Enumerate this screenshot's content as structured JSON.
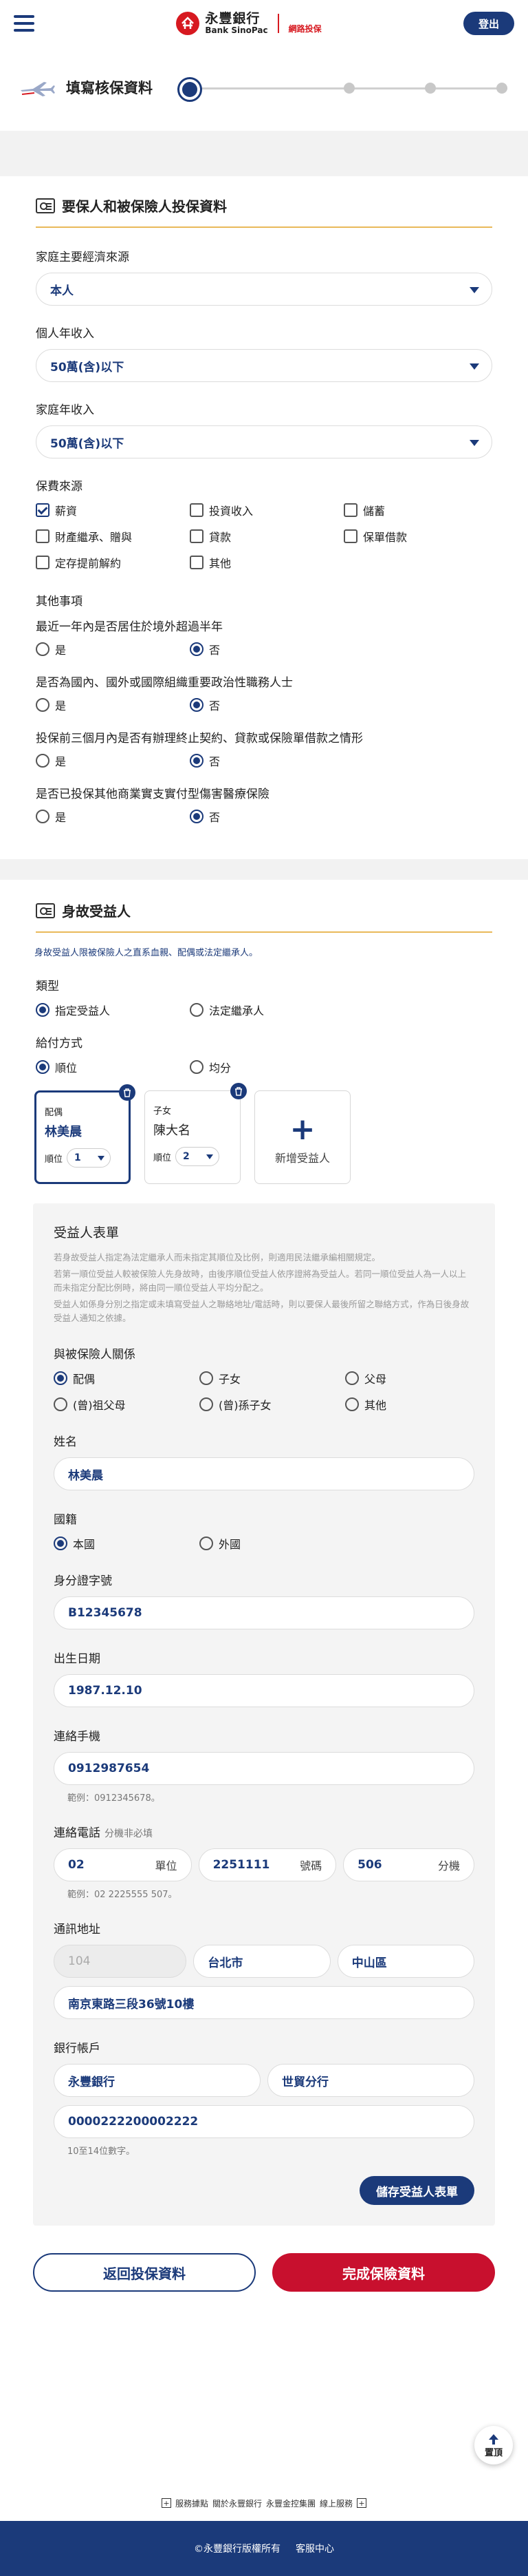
{
  "header": {
    "brand_cn": "永豐銀行",
    "brand_en": "Bank SinoPac",
    "brand_tag": "網路投保",
    "logout_label": "登出"
  },
  "stepper": {
    "title": "填寫核保資料",
    "current_step": 1,
    "total_steps": 4
  },
  "policyholder": {
    "title": "要保人和被保險人投保資料",
    "income_source_label": "家庭主要經濟來源",
    "income_source_value": "本人",
    "personal_income_label": "個人年收入",
    "personal_income_value": "50萬(含)以下",
    "family_income_label": "家庭年收入",
    "family_income_value": "50萬(含)以下",
    "premium_source_label": "保費來源",
    "premium_sources": [
      {
        "label": "薪資",
        "checked": true
      },
      {
        "label": "投資收入",
        "checked": false
      },
      {
        "label": "儲蓄",
        "checked": false
      },
      {
        "label": "財產繼承、贈與",
        "checked": false
      },
      {
        "label": "貸款",
        "checked": false
      },
      {
        "label": "保單借款",
        "checked": false
      },
      {
        "label": "定存提前解約",
        "checked": false
      },
      {
        "label": "其他",
        "checked": false
      }
    ],
    "other_label": "其他事項",
    "yes_label": "是",
    "no_label": "否",
    "questions": [
      {
        "text": "最近一年內是否居住於境外超過半年",
        "answer": "否"
      },
      {
        "text": "是否為國內、國外或國際組織重要政治性職務人士",
        "answer": "否"
      },
      {
        "text": "投保前三個月內是否有辦理終止契約、貸款或保險單借款之情形",
        "answer": "否"
      },
      {
        "text": "是否已投保其他商業實支實付型傷害醫療保險",
        "answer": "否"
      }
    ]
  },
  "beneficiary": {
    "title": "身故受益人",
    "note": "身故受益人限被保險人之直系血親、配偶或法定繼承人。",
    "type_label": "類型",
    "type_options": [
      "指定受益人",
      "法定繼承人"
    ],
    "type_selected": "指定受益人",
    "pay_label": "給付方式",
    "pay_options": [
      "順位",
      "均分"
    ],
    "pay_selected": "順位",
    "order_label": "順位",
    "cards": [
      {
        "relation": "配偶",
        "name": "林美晨",
        "order": "1"
      },
      {
        "relation": "子女",
        "name": "陳大名",
        "order": "2"
      }
    ],
    "add_label": "新增受益人",
    "form": {
      "title": "受益人表單",
      "notes": [
        "若身故受益人指定為法定繼承人而未指定其順位及比例，則適用民法繼承編相關規定。",
        "若第一順位受益人較被保險人先身故時，由後序順位受益人依序證將為受益人。若同一順位受益人為一人以上而未指定分配比例時，將由同一順位受益人平均分配之。",
        "受益人如係身分別之指定或未填寫受益人之聯絡地址/電話時，則以要保人最後所留之聯絡方式，作為日後身故受益人通知之依據。"
      ],
      "relation_label": "與被保險人關係",
      "relations": [
        {
          "label": "配偶",
          "checked": true
        },
        {
          "label": "子女",
          "checked": false
        },
        {
          "label": "父母",
          "checked": false
        },
        {
          "label": "(曾)祖父母",
          "checked": false
        },
        {
          "label": "(曾)孫子女",
          "checked": false
        },
        {
          "label": "其他",
          "checked": false
        }
      ],
      "name_label": "姓名",
      "name_value": "林美晨",
      "nationality_label": "國籍",
      "nationality_options": [
        "本國",
        "外國"
      ],
      "nationality_selected": "本國",
      "id_label": "身分證字號",
      "id_value": "B12345678",
      "birth_label": "出生日期",
      "birth_value": "1987.12.10",
      "mobile_label": "連絡手機",
      "mobile_value": "0912987654",
      "mobile_hint": "範例：0912345678。",
      "phone_label": "連絡電話",
      "phone_note": "分機非必填",
      "phone_area": "02",
      "phone_area_suffix": "單位",
      "phone_number": "2251111",
      "phone_number_suffix": "號碼",
      "phone_ext": "506",
      "phone_ext_suffix": "分機",
      "phone_hint": "範例：02 2225555 507。",
      "address_label": "通訊地址",
      "zip_value": "104",
      "city_value": "台北市",
      "district_value": "中山區",
      "street_value": "南京東路三段36號10樓",
      "bank_label": "銀行帳戶",
      "bank_value": "永豐銀行",
      "branch_value": "世貿分行",
      "account_value": "0000222200002222",
      "account_hint": "10至14位數字。",
      "save_label": "儲存受益人表單"
    }
  },
  "actions": {
    "back_label": "返回投保資料",
    "submit_label": "完成保險資料",
    "totop_label": "置頂"
  },
  "footer": {
    "links": [
      "服務據點",
      "關於永豐銀行",
      "永豐金控集團",
      "線上服務"
    ],
    "copyright": "©永豐銀行版權所有",
    "service": "客服中心"
  }
}
